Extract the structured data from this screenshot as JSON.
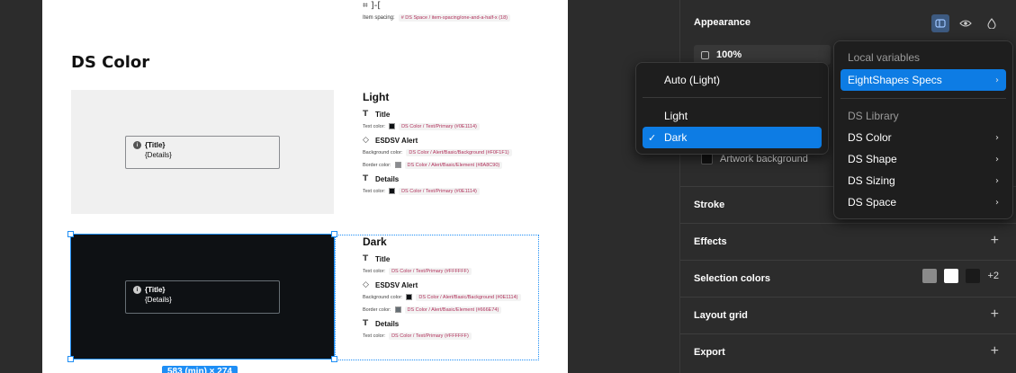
{
  "canvas": {
    "top_spacing_icon": "⌗ ]-[",
    "item_spacing": {
      "label": "Item spacing:",
      "token": "# DS Space / item-spacing/one-and-a-half-x (18)"
    },
    "section_title": "DS Color",
    "light_preview": {
      "alert_title": "{Title}",
      "alert_details": "{Details}",
      "info_glyph": "i"
    },
    "dark_preview": {
      "alert_title": "{Title}",
      "alert_details": "{Details}",
      "info_glyph": "i"
    },
    "dimension_label": "583 (min) × 274",
    "light_spec": {
      "heading": "Light",
      "title_item": "Title",
      "title_text_color_label": "Text color:",
      "title_text_color_token": "DS Color / Text/Primary (#0E1114)",
      "alert_item": "ESDSV Alert",
      "alert_bg_label": "Background color:",
      "alert_bg_token": "DS Color / Alert/Basic/Background (#F0F1F1)",
      "alert_border_label": "Border color:",
      "alert_border_token": "DS Color / Alert/Basic/Element (#8A8C90)",
      "details_item": "Details",
      "details_text_color_label": "Text color:",
      "details_text_color_token": "DS Color / Text/Primary (#0E1114)"
    },
    "dark_spec": {
      "heading": "Dark",
      "title_item": "Title",
      "title_text_color_label": "Text color:",
      "title_text_color_token": "DS Color / Text/Primary (#FFFFFF)",
      "alert_item": "ESDSV Alert",
      "alert_bg_label": "Background color:",
      "alert_bg_token": "DS Color / Alert/Basic/Background (#0E1114)",
      "alert_border_label": "Border color:",
      "alert_border_token": "DS Color / Alert/Basic/Element (#666E74)",
      "details_item": "Details",
      "details_text_color_label": "Text color:",
      "details_text_color_token": "DS Color / Text/Primary (#FFFFFF)"
    }
  },
  "panel": {
    "appearance": {
      "title": "Appearance",
      "opacity": "100%",
      "artwork_label": "Artwork background"
    },
    "stroke": {
      "title": "Stroke"
    },
    "effects": {
      "title": "Effects",
      "add": "+"
    },
    "selection_colors": {
      "title": "Selection colors",
      "more": "+2",
      "colors": [
        "#8a8a8a",
        "#ffffff",
        "#1a1a1a"
      ]
    },
    "layout_grid": {
      "title": "Layout grid",
      "add": "+"
    },
    "export": {
      "title": "Export",
      "add": "+"
    }
  },
  "mode_menu": {
    "auto": "Auto (Light)",
    "light": "Light",
    "dark": "Dark",
    "check": "✓"
  },
  "library_menu": {
    "local_heading": "Local variables",
    "local_item": "EightShapes Specs",
    "library_heading": "DS Library",
    "items": [
      "DS Color",
      "DS Shape",
      "DS Sizing",
      "DS Space"
    ],
    "arrow": "›"
  },
  "colors": {
    "accent": "#0d7ce4",
    "selection": "#1e8ef5",
    "dark_preview_bg": "#0e1114",
    "light_preview_bg": "#f0f0f0"
  }
}
